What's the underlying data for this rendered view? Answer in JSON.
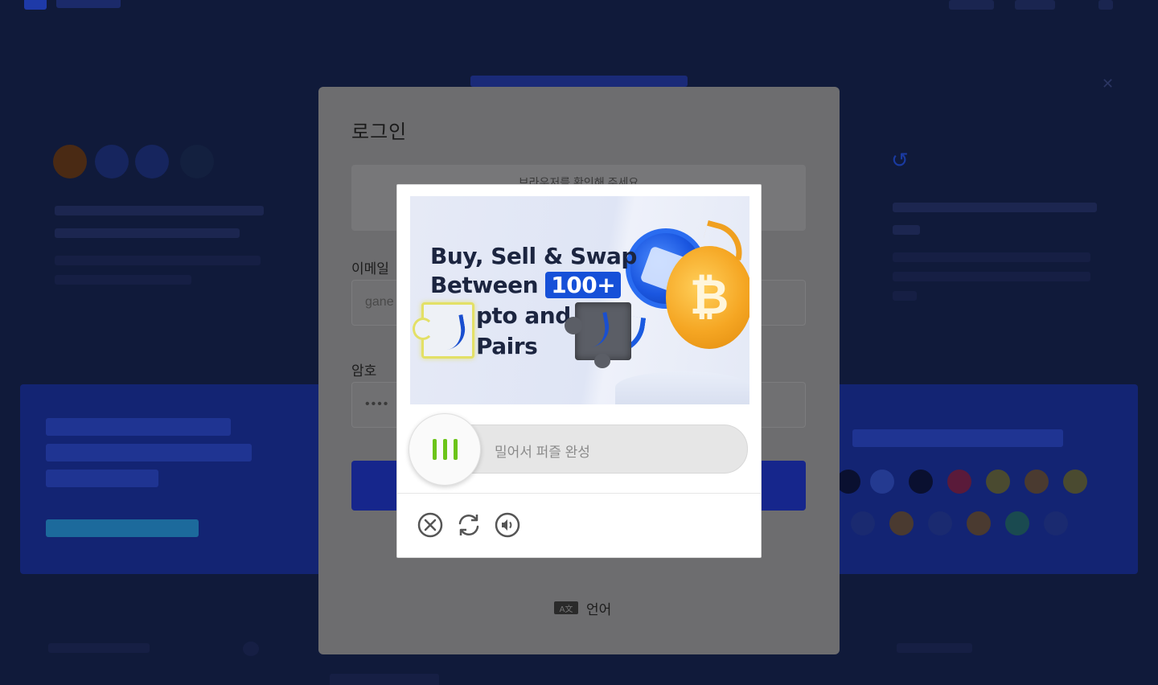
{
  "login": {
    "title": "로그인",
    "notice": "브라우저를 확인해 주세요",
    "email_label": "이메일",
    "email_value": "gane",
    "password_label": "암호",
    "password_value": "••••",
    "language_label": "언어",
    "language_icon": "translate-icon"
  },
  "captcha": {
    "promo": {
      "line1": "Buy, Sell & Swap",
      "line2_prefix": "Between",
      "line2_badge": "100+",
      "line3": "pto and",
      "line4": "Pairs"
    },
    "slider_hint": "밀어서 퍼즐 완성",
    "tools": [
      "close-icon",
      "refresh-icon",
      "audio-icon"
    ],
    "colors": {
      "grip": "#6cc419",
      "badge": "#1650d8",
      "piece_outline": "#e3e066"
    }
  }
}
